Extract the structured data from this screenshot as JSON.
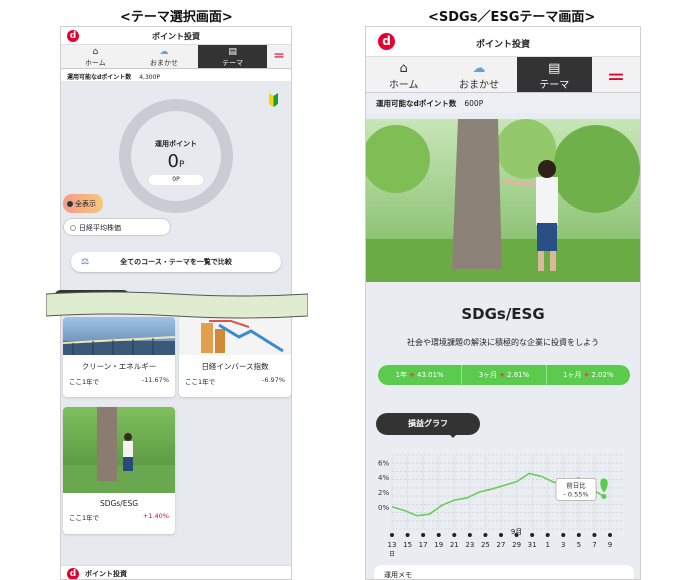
{
  "captions": {
    "left": "<テーマ選択画面>",
    "right": "<SDGs／ESGテーマ画面>"
  },
  "app": {
    "logo": "d",
    "title": "ポイント投資",
    "tabs": [
      {
        "label": "ホーム",
        "icon": "home-icon"
      },
      {
        "label": "おまかせ",
        "icon": "cloud-icon"
      },
      {
        "label": "テーマ",
        "icon": "document-icon"
      }
    ],
    "menu_icon": "menu-icon"
  },
  "left": {
    "points_label": "運用可能なdポイント数",
    "points_value": "4,300P",
    "ring": {
      "label": "運用ポイント",
      "value": "0",
      "unit": "P",
      "sub": "0P"
    },
    "filters": {
      "all": "全表示",
      "nikkei": "日経平均株価"
    },
    "compare_button": "全てのコース・テーマを一覧で比較",
    "cards": [
      {
        "title": "クリーン・エネルギー",
        "period": "ここ1年で",
        "change": "-11.67%"
      },
      {
        "title": "日経インバース指数",
        "period": "ここ1年で",
        "change": "-6.97%"
      },
      {
        "title": "SDGs/ESG",
        "period": "ここ1年で",
        "change": "+1.40%"
      }
    ],
    "footer_title": "ポイント投資"
  },
  "right": {
    "points_label": "運用可能なdポイント数",
    "points_value": "600P",
    "title": "SDGs/ESG",
    "description": "社会や環境課題の解決に積極的な企業に投資をしよう",
    "performance": [
      {
        "period": "1年",
        "value": "43.01%"
      },
      {
        "period": "3ヶ月",
        "value": "2.81%"
      },
      {
        "period": "1ヶ月",
        "value": "2.02%"
      }
    ],
    "graph_label": "損益グラフ",
    "footer_text": "運用メモ"
  },
  "chart_data": {
    "type": "line",
    "y_ticks": [
      "6%",
      "4%",
      "2%",
      "0%"
    ],
    "ylim": [
      -3,
      7
    ],
    "x_ticks": [
      "13",
      "15",
      "17",
      "19",
      "21",
      "23",
      "25",
      "27",
      "29",
      "31",
      "1",
      "3",
      "5",
      "7",
      "9"
    ],
    "x_start_label": "日",
    "month_label": "9月",
    "tooltip": {
      "label": "前日比",
      "value": "- 0.55%"
    },
    "series": [
      {
        "values": [
          0,
          -0.5,
          -1.2,
          -1.0,
          0.2,
          0.9,
          1.2,
          2.0,
          2.4,
          2.9,
          3.4,
          4.5,
          4.1,
          3.3,
          3.5,
          3.9,
          2.4,
          1.4
        ]
      }
    ],
    "colors": {
      "line": "#6ccb5f",
      "marker": "#5bcb4e"
    }
  },
  "colors": {
    "brand": "#e6002d",
    "green": "#5bcb4e",
    "positive": "#c8102e"
  }
}
